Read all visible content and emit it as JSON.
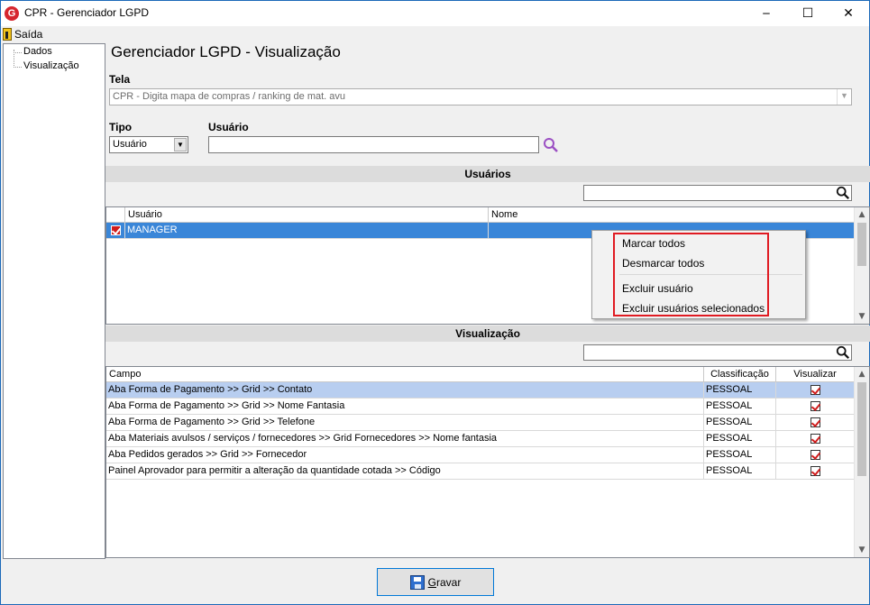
{
  "window": {
    "title": "CPR - Gerenciador LGPD",
    "app_icon_letter": "G",
    "minimize_label": "‒",
    "maximize_label": "☐",
    "close_label": "✕"
  },
  "menu": {
    "saida": "Saída"
  },
  "tree": {
    "items": [
      "Dados",
      "Visualização"
    ]
  },
  "page": {
    "title": "Gerenciador LGPD - Visualização",
    "tela_label": "Tela",
    "tela_value": "CPR - Digita mapa de compras / ranking de mat. avu",
    "tipo_label": "Tipo",
    "tipo_value": "Usuário",
    "usuario_label": "Usuário",
    "usuario_value": ""
  },
  "usuarios_section": {
    "title": "Usuários",
    "search_value": "",
    "columns": [
      "Usuário",
      "Nome"
    ],
    "rows": [
      {
        "checked": true,
        "usuario": "MANAGER",
        "nome": ""
      }
    ]
  },
  "context_menu": {
    "items": [
      "Marcar todos",
      "Desmarcar todos",
      "Excluir usuário",
      "Excluir usuários selecionados"
    ]
  },
  "visualizacao_section": {
    "title": "Visualização",
    "search_value": "",
    "columns": [
      "Campo",
      "Classificação",
      "Visualizar"
    ],
    "rows": [
      {
        "campo": "Aba Forma de Pagamento >> Grid >> Contato",
        "classificacao": "PESSOAL",
        "visualizar": true
      },
      {
        "campo": "Aba Forma de Pagamento >> Grid >> Nome Fantasia",
        "classificacao": "PESSOAL",
        "visualizar": true
      },
      {
        "campo": "Aba Forma de Pagamento >> Grid >> Telefone",
        "classificacao": "PESSOAL",
        "visualizar": true
      },
      {
        "campo": "Aba Materiais avulsos / serviços / fornecedores >> Grid Fornecedores >> Nome fantasia",
        "classificacao": "PESSOAL",
        "visualizar": true
      },
      {
        "campo": "Aba Pedidos gerados >> Grid >> Fornecedor",
        "classificacao": "PESSOAL",
        "visualizar": true
      },
      {
        "campo": "Painel Aprovador para permitir a alteração da quantidade cotada >> Código",
        "classificacao": "PESSOAL",
        "visualizar": true
      }
    ]
  },
  "footer": {
    "gravar_first": "G",
    "gravar_rest": "ravar"
  },
  "icons": {
    "search": "search-icon",
    "floppy": "floppy-disk-icon",
    "exit": "exit-door-icon"
  },
  "colors": {
    "selection": "#3a86d8",
    "highlight": "#b8cef0",
    "context_outline": "#e01b22",
    "check": "#d01c1c"
  }
}
